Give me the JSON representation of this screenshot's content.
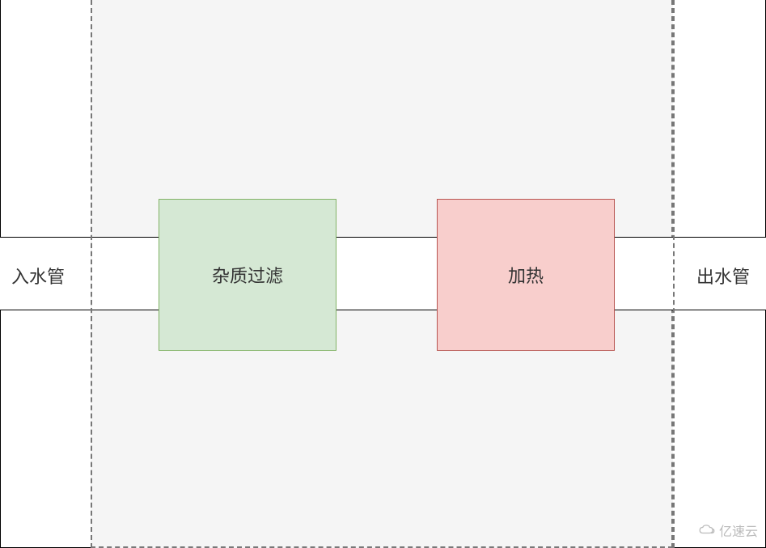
{
  "diagram": {
    "input_pipe_label": "入水管",
    "output_pipe_label": "出水管",
    "filter_box_label": "杂质过滤",
    "heat_box_label": "加热"
  },
  "watermark": {
    "text": "亿速云"
  },
  "colors": {
    "filter_bg": "#d5e8d4",
    "filter_border": "#82b366",
    "heat_bg": "#f8cecc",
    "heat_border": "#b85450",
    "container_bg": "#f5f5f5",
    "dash_color": "#777"
  }
}
